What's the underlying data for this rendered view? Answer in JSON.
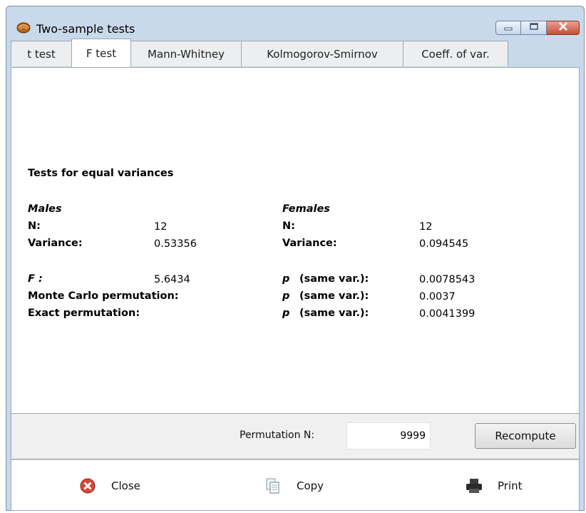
{
  "window": {
    "title": "Two-sample tests",
    "icons": [
      "app-shell-icon",
      "minimize-icon",
      "maximize-icon",
      "close-window-icon"
    ]
  },
  "tabs": [
    {
      "label": "t test",
      "active": false
    },
    {
      "label": "F test",
      "active": true
    },
    {
      "label": "Mann-Whitney",
      "active": false
    },
    {
      "label": "Kolmogorov-Smirnov",
      "active": false
    },
    {
      "label": "Coeff. of var.",
      "active": false
    }
  ],
  "results": {
    "heading": "Tests for equal variances",
    "group1": {
      "name": "Males",
      "n_label": "N:",
      "n": "12",
      "var_label": "Variance:",
      "variance": "0.53356"
    },
    "group2": {
      "name": "Females",
      "n_label": "N:",
      "n": "12",
      "var_label": "Variance:",
      "variance": "0.094545"
    },
    "f_label": "F :",
    "f_value": "5.6434",
    "monte_carlo_label": "Monte Carlo permutation:",
    "exact_label": "Exact permutation:",
    "p_label": "p",
    "p_suffix": "(same var.):",
    "p_f": "0.0078543",
    "p_monte_carlo": "0.0037",
    "p_exact": "0.0041399"
  },
  "permutation": {
    "label": "Permutation N:",
    "value": "9999",
    "button": "Recompute"
  },
  "actions": [
    {
      "label": "Close",
      "icon": "close-circle-icon",
      "color": "#d8463a"
    },
    {
      "label": "Copy",
      "icon": "copy-icon"
    },
    {
      "label": "Print",
      "icon": "printer-icon"
    }
  ]
}
